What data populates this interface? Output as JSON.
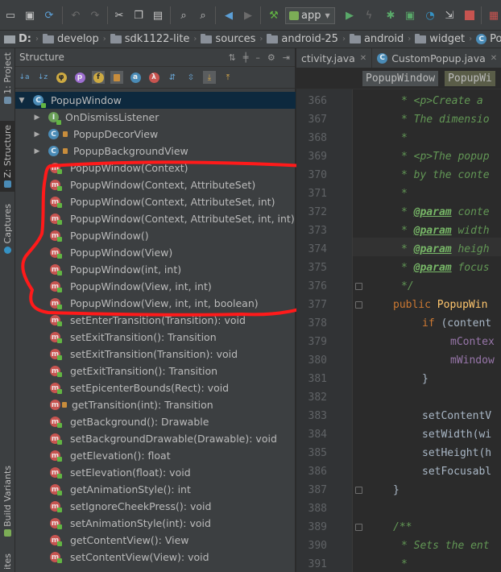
{
  "toolbar": {
    "run_config": "app"
  },
  "navbar": {
    "crumbs": [
      "D:",
      "develop",
      "sdk1122-lite",
      "sources",
      "android-25",
      "android",
      "widget",
      "PopupWi"
    ]
  },
  "left_strip": {
    "project": "1: Project",
    "structure": "Z: Structure",
    "captures": "Captures",
    "build_variants": "Build Variants",
    "favorites": "ites"
  },
  "structure": {
    "title": "Structure",
    "root": "PopupWindow",
    "inner_classes": [
      "OnDismissListener",
      "PopupDecorView",
      "PopupBackgroundView"
    ],
    "members": [
      "PopupWindow(Context)",
      "PopupWindow(Context, AttributeSet)",
      "PopupWindow(Context, AttributeSet, int)",
      "PopupWindow(Context, AttributeSet, int, int)",
      "PopupWindow()",
      "PopupWindow(View)",
      "PopupWindow(int, int)",
      "PopupWindow(View, int, int)",
      "PopupWindow(View, int, int, boolean)",
      "setEnterTransition(Transition): void",
      "setExitTransition(): Transition",
      "setExitTransition(Transition): void",
      "getExitTransition(): Transition",
      "setEpicenterBounds(Rect): void",
      "getTransition(int): Transition",
      "getBackground(): Drawable",
      "setBackgroundDrawable(Drawable): void",
      "getElevation(): float",
      "setElevation(float): void",
      "getAnimationStyle(): int",
      "setIgnoreCheekPress(): void",
      "setAnimationStyle(int): void",
      "getContentView(): View",
      "setContentView(View): void"
    ]
  },
  "editor": {
    "tabs": [
      "ctivity.java",
      "CustomPopup.java"
    ],
    "breadcrumbs": [
      "PopupWindow",
      "PopupWi"
    ],
    "line_numbers": [
      "366",
      "367",
      "368",
      "369",
      "370",
      "371",
      "372",
      "373",
      "374",
      "375",
      "376",
      "377",
      "378",
      "379",
      "380",
      "381",
      "382",
      "383",
      "384",
      "385",
      "386",
      "387",
      "388",
      "389",
      "390",
      "391"
    ],
    "code": {
      "l366": "* <p>Create a",
      "l367": "* The dimensio",
      "l368": "*",
      "l369": "* <p>The popup",
      "l370": "* by the conte",
      "l371": "*",
      "l372_tag": "@param",
      "l372_rest": " conte",
      "l373_tag": "@param",
      "l373_rest": " width",
      "l374_tag": "@param",
      "l374_rest": " heigh",
      "l375_tag": "@param",
      "l375_rest": " focus",
      "l376": "*/",
      "l377_kw": "public",
      "l377_fn": " PopupWin",
      "l378_kw": "if",
      "l378_rest": " (content",
      "l379": "mContex",
      "l380": "mWindow",
      "l381": "}",
      "l383": "setContentV",
      "l384": "setWidth(wi",
      "l385": "setHeight(h",
      "l386": "setFocusabl",
      "l387": "}",
      "l389": "/**",
      "l390": "* Sets the ent",
      "l391": "*"
    }
  }
}
